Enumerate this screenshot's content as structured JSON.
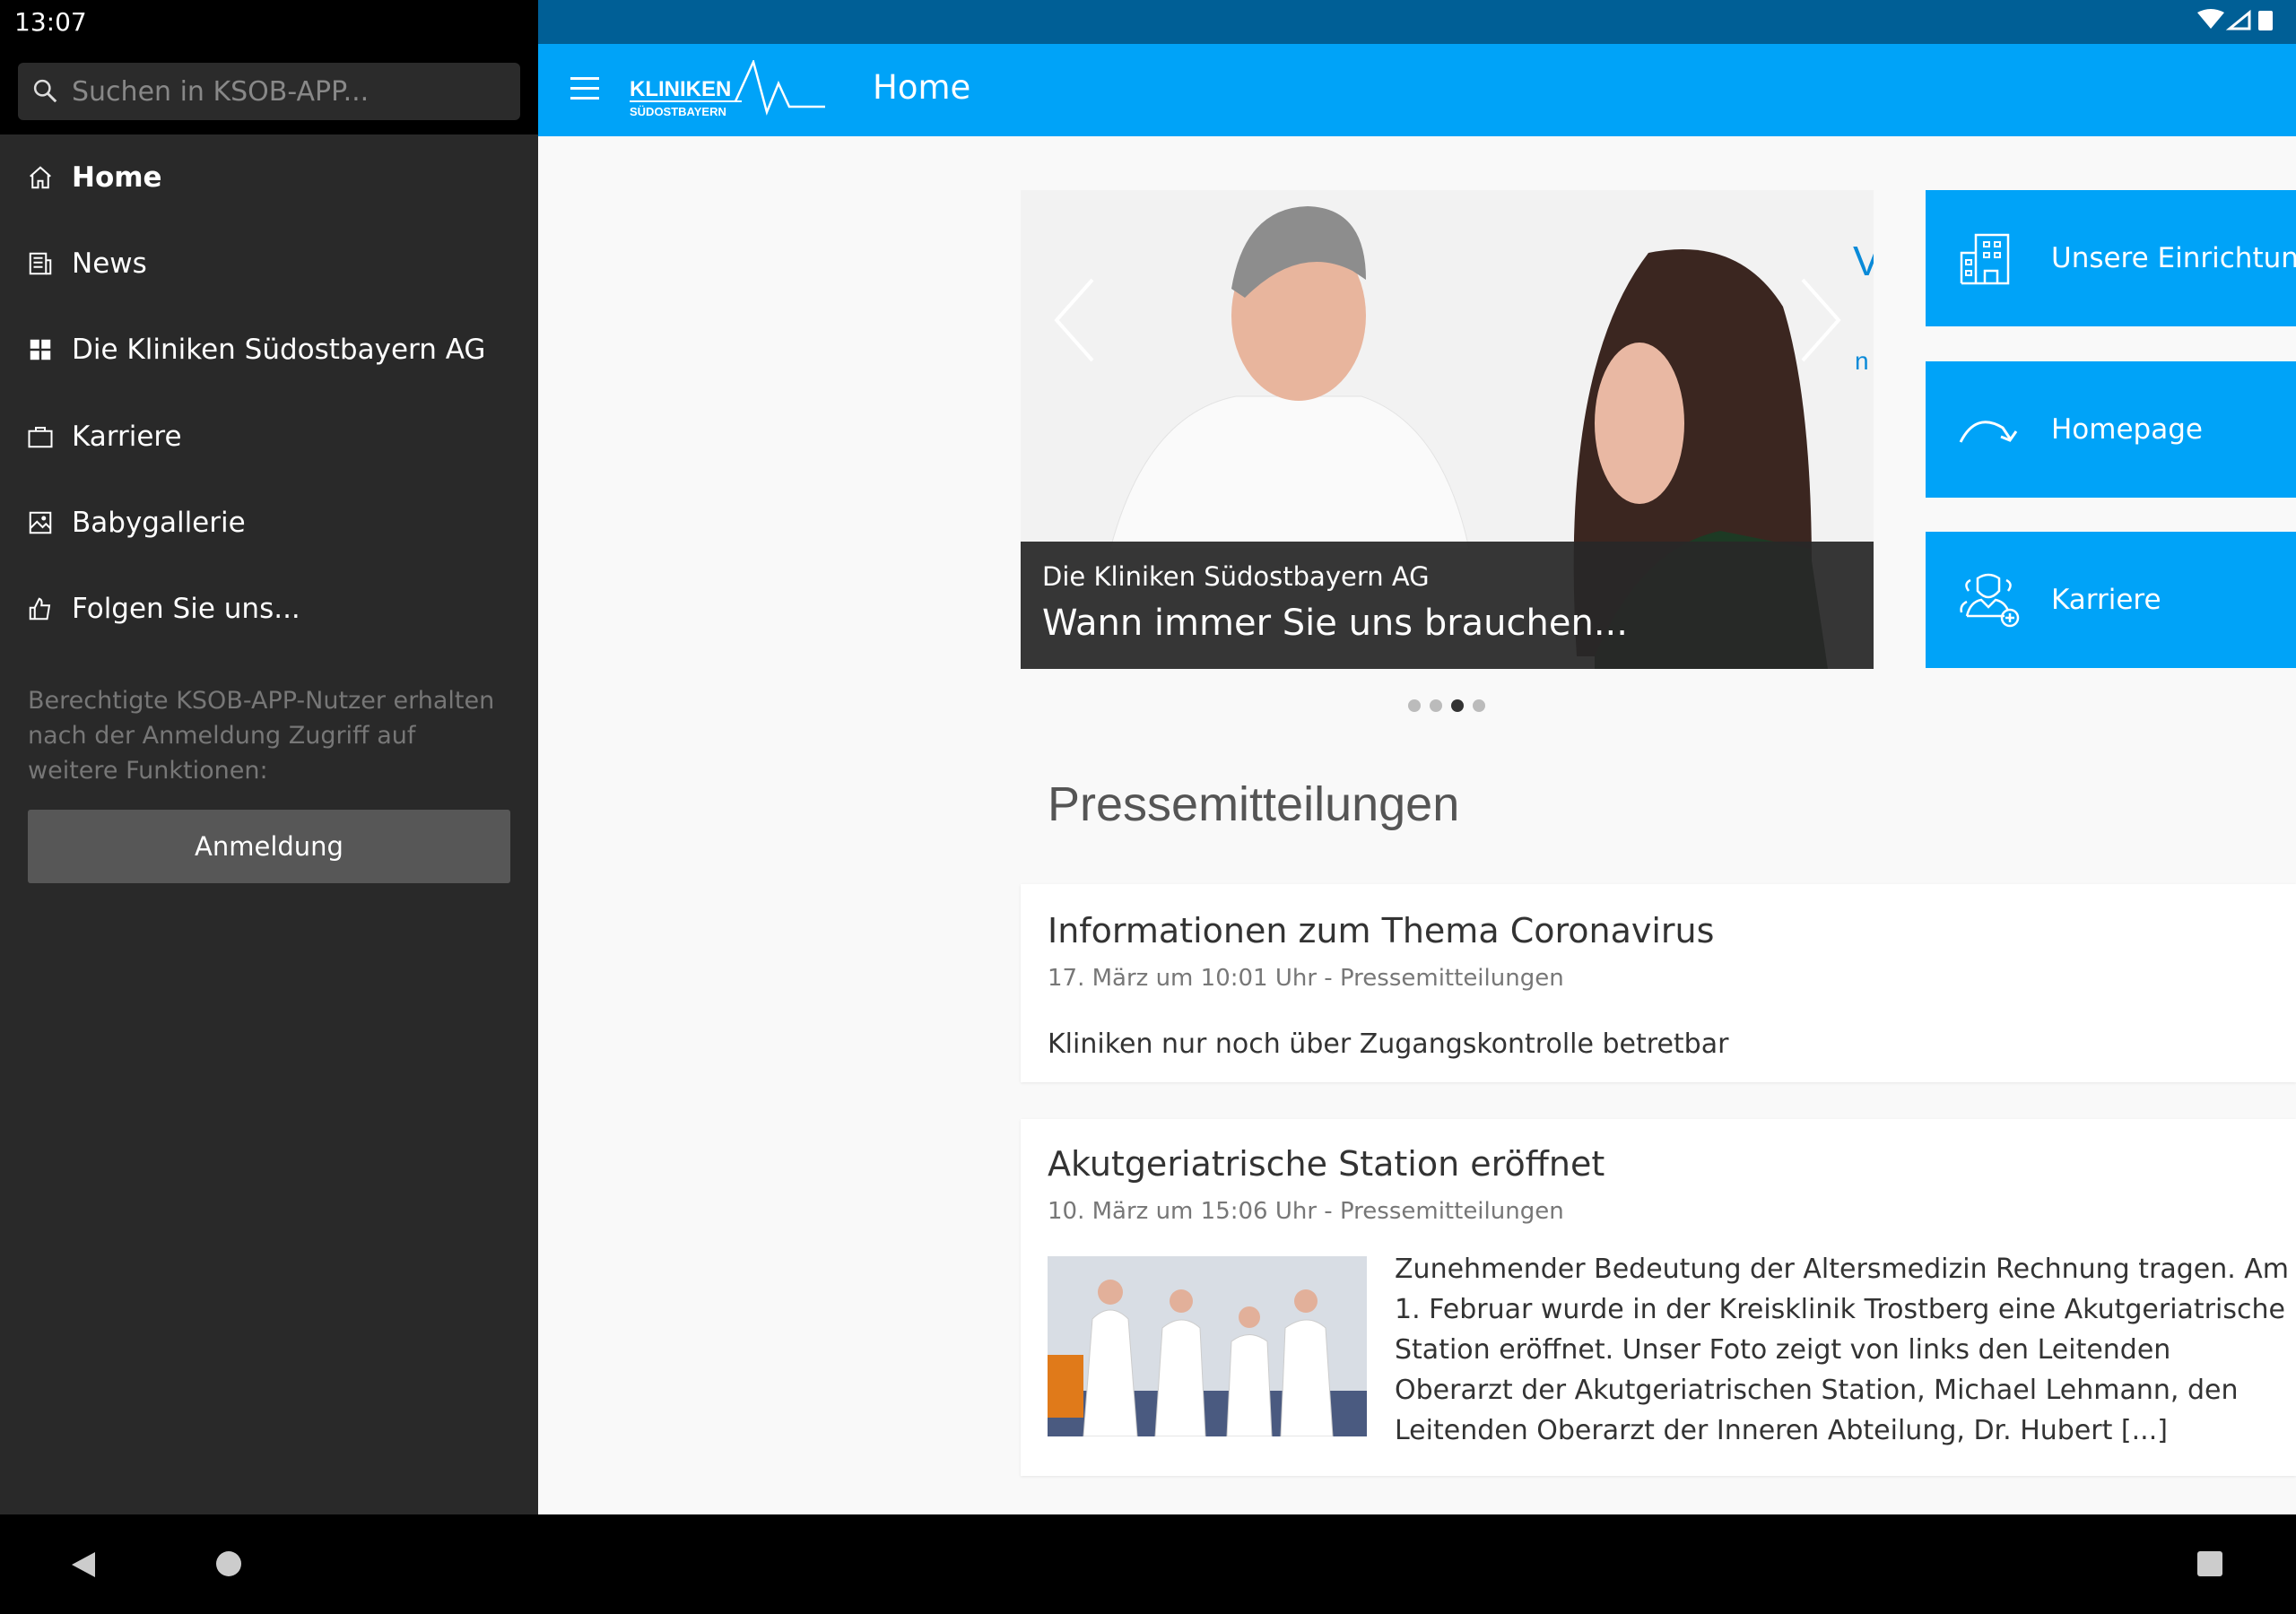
{
  "status": {
    "time": "13:07"
  },
  "drawer": {
    "search_placeholder": "Suchen in KSOB-APP...",
    "items": [
      {
        "label": "Home",
        "icon": "home-icon"
      },
      {
        "label": "News",
        "icon": "news-icon"
      },
      {
        "label": "Die Kliniken Südostbayern AG",
        "icon": "grid-icon"
      },
      {
        "label": "Karriere",
        "icon": "briefcase-icon"
      },
      {
        "label": "Babygallerie",
        "icon": "image-icon"
      },
      {
        "label": "Folgen Sie uns...",
        "icon": "thumbs-up-icon"
      }
    ],
    "info": "Berechtigte KSOB-APP-Nutzer erhalten nach der Anmeldung Zugriff auf weitere Funktionen:",
    "login_label": "Anmeldung"
  },
  "appbar": {
    "logo_top": "KLINIKEN",
    "logo_bottom": "SÜDOSTBAYERN",
    "title": "Home",
    "color": "#00a3f8"
  },
  "carousel": {
    "subtitle": "Die Kliniken Südostbayern AG",
    "title": "Wann immer Sie uns brauchen...",
    "side_text_1": "V",
    "side_text_2": "n",
    "dots": 4,
    "active_dot": 3
  },
  "tiles": [
    {
      "label": "Unsere Einrichtungen",
      "icon": "building-icon"
    },
    {
      "label": "Homepage",
      "icon": "redirect-arrow-icon"
    },
    {
      "label": "Karriere",
      "icon": "doctor-team-icon"
    }
  ],
  "press": {
    "heading": "Pressemitteilungen",
    "items": [
      {
        "title": "Informationen zum Thema Coronavirus",
        "meta": "17. März um 10:01 Uhr - Pressemitteilungen",
        "body": "Kliniken nur noch über Zugangskontrolle betretbar"
      },
      {
        "title": "Akutgeriatrische Station eröffnet",
        "meta": "10. März um 15:06 Uhr - Pressemitteilungen",
        "body": "Zunehmender Bedeutung der Altersmedizin Rechnung tragen. Am 1. Februar wurde in der Kreisklinik Trostberg eine Akutgeriatrische Station eröffnet. Unser Foto zeigt von links den Leitenden Oberarzt der Akutgeriatrischen Station, Michael Lehmann, den Leitenden Oberarzt der Inneren Abteilung, Dr. Hubert [...]"
      }
    ]
  }
}
